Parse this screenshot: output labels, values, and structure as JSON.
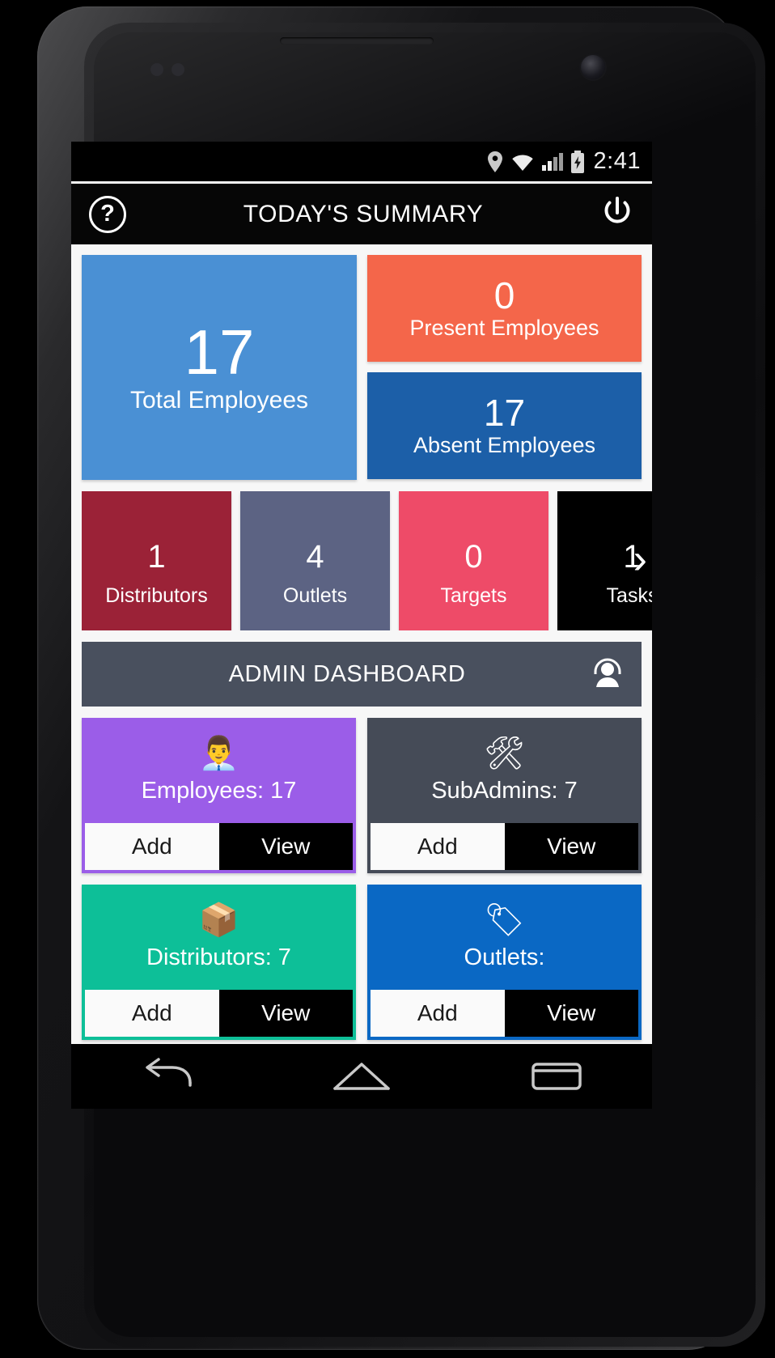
{
  "device": {
    "platform": "android"
  },
  "status_bar": {
    "icons": [
      "location-pin-icon",
      "wifi-icon",
      "cellular-signal-icon",
      "battery-charging-icon"
    ],
    "clock": "2:41"
  },
  "title_bar": {
    "help_label": "?",
    "title": "TODAY'S SUMMARY",
    "power_icon": "power-icon"
  },
  "summary": {
    "total": {
      "value": "17",
      "label": "Total Employees",
      "color": "#4a90d4"
    },
    "present": {
      "value": "0",
      "label": "Present Employees",
      "color": "#f4664a"
    },
    "absent": {
      "value": "17",
      "label": "Absent Employees",
      "color": "#1c5fa8"
    }
  },
  "strip": {
    "chevron": "›",
    "tiles": [
      {
        "num": "1",
        "caption": "Distributors",
        "color": "#9b2237"
      },
      {
        "num": "4",
        "caption": "Outlets",
        "color": "#5c6383"
      },
      {
        "num": "0",
        "caption": "Targets",
        "color": "#ee4b68"
      },
      {
        "num": "1",
        "caption": "Tasks",
        "color": "#000000"
      }
    ]
  },
  "admin_bar": {
    "title": "ADMIN DASHBOARD",
    "icon": "headset-agent-icon",
    "color": "#49505e"
  },
  "admin_cards": [
    {
      "icon": "office-worker-icon",
      "emoji": "👨‍💼",
      "label": "Employees: 17",
      "color": "#9b5de8",
      "add_label": "Add",
      "view_label": "View"
    },
    {
      "icon": "gear-wrench-icon",
      "emoji": "🛠",
      "label": "SubAdmins: 7",
      "color": "#454b57",
      "add_label": "Add",
      "view_label": "View"
    },
    {
      "icon": "distribution-network-icon",
      "emoji": "📦",
      "label": "Distributors: 7",
      "color": "#0dbf98",
      "add_label": "Add",
      "view_label": "View"
    },
    {
      "icon": "outlet-price-tag-icon",
      "emoji": "🏷",
      "label": "Outlets:",
      "color": "#0a68c4",
      "add_label": "Add",
      "view_label": "View"
    }
  ],
  "nav_bar": {
    "back": "back-icon",
    "home": "home-icon",
    "recents": "recents-icon"
  }
}
